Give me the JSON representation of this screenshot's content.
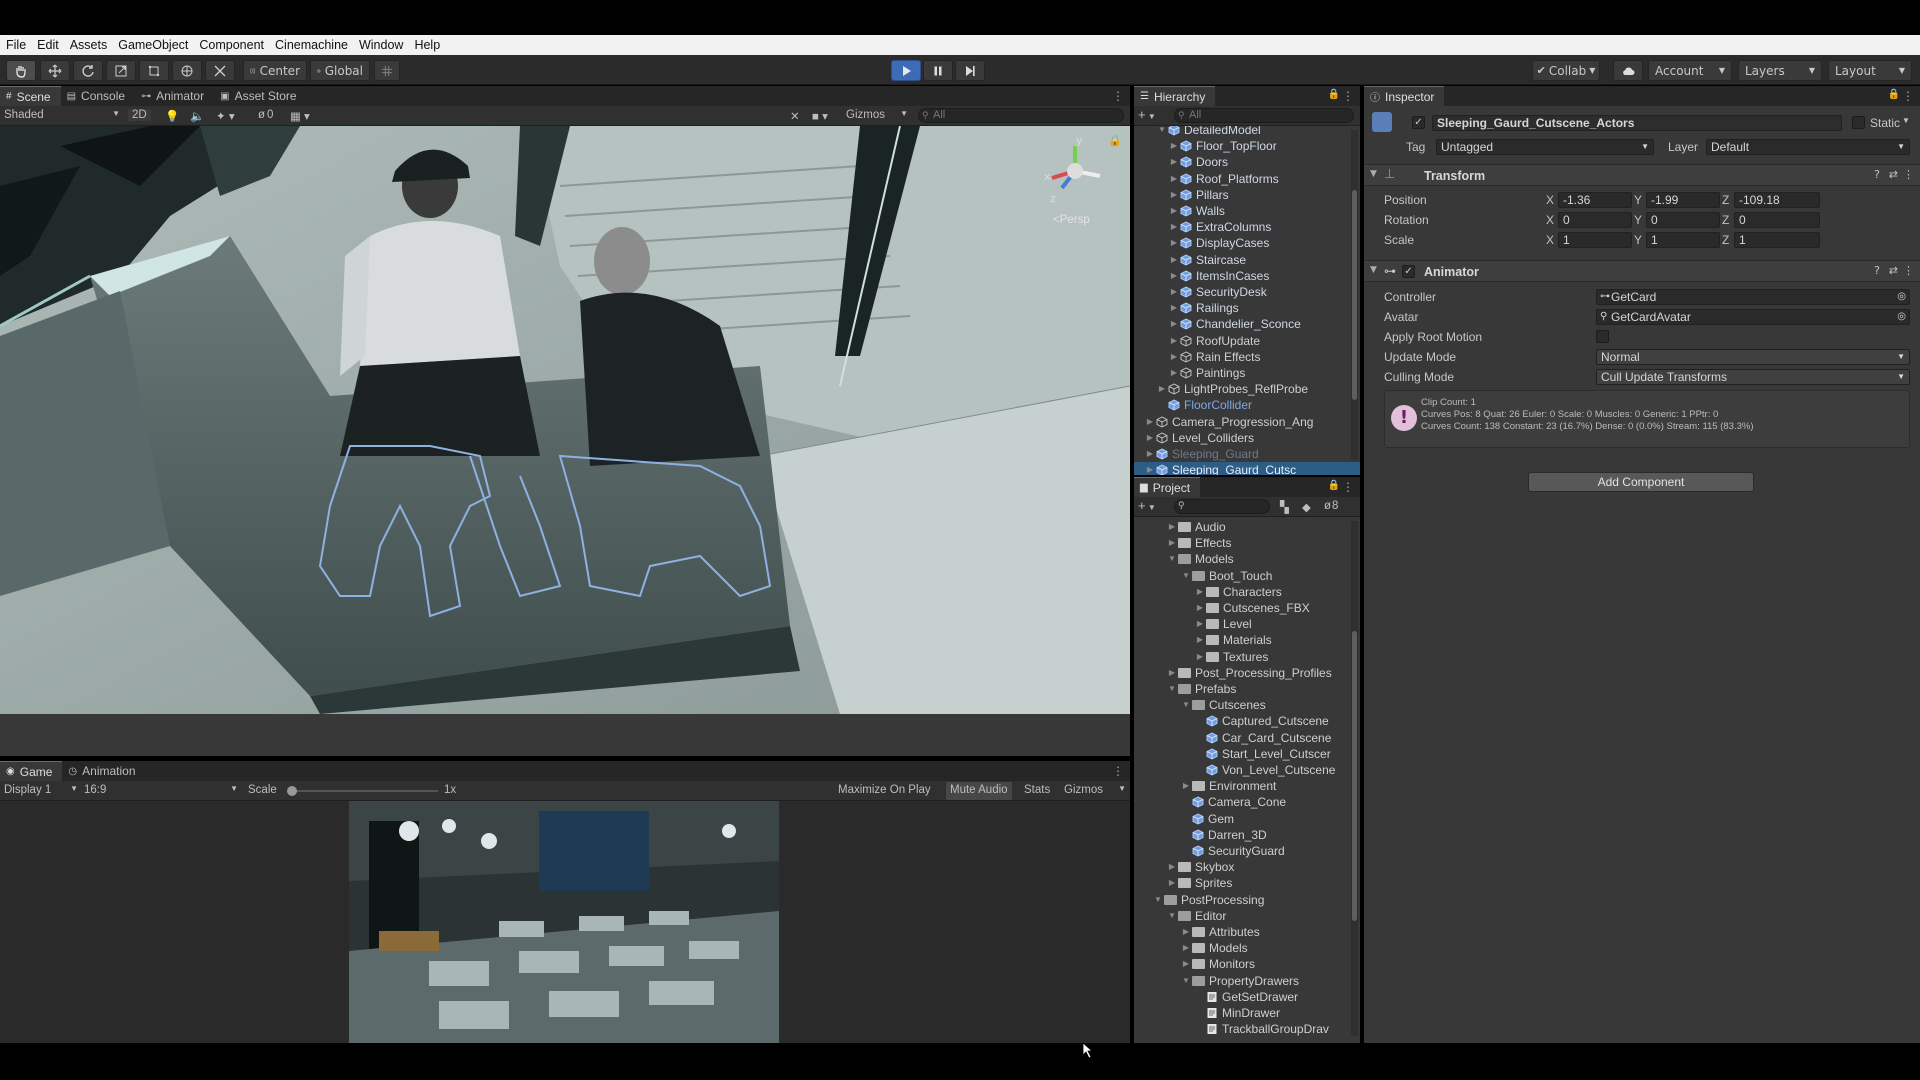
{
  "menu": [
    "File",
    "Edit",
    "Assets",
    "GameObject",
    "Component",
    "Cinemachine",
    "Window",
    "Help"
  ],
  "toolbar": {
    "pivot": "Center",
    "space": "Global",
    "collab": "Collab",
    "account": "Account",
    "layers": "Layers",
    "layout": "Layout"
  },
  "scene_panel": {
    "tabs": [
      "Scene",
      "Console",
      "Animator",
      "Asset Store"
    ],
    "shading": "Shaded",
    "mode2d": "2D",
    "fx_count": "0",
    "gizmos": "Gizmos",
    "search_placeholder": "All",
    "persp": "<Persp",
    "axis_x": "x",
    "axis_y": "y",
    "axis_z": "z"
  },
  "game_panel": {
    "tabs": [
      "Game",
      "Animation"
    ],
    "display": "Display 1",
    "aspect": "16:9",
    "scale_label": "Scale",
    "scale_value": "1x",
    "maximize": "Maximize On Play",
    "mute": "Mute Audio",
    "stats": "Stats",
    "gizmos": "Gizmos"
  },
  "hierarchy": {
    "title": "Hierarchy",
    "search_placeholder": "All",
    "items": [
      {
        "label": "DetailedModel",
        "depth": 4,
        "icon": "prefab",
        "arrow": "open"
      },
      {
        "label": "Floor_TopFloor",
        "depth": 5,
        "icon": "prefab",
        "arrow": "closed"
      },
      {
        "label": "Doors",
        "depth": 5,
        "icon": "prefab",
        "arrow": "closed"
      },
      {
        "label": "Roof_Platforms",
        "depth": 5,
        "icon": "prefab",
        "arrow": "closed"
      },
      {
        "label": "Pillars",
        "depth": 5,
        "icon": "prefab",
        "arrow": "closed"
      },
      {
        "label": "Walls",
        "depth": 5,
        "icon": "prefab",
        "arrow": "closed"
      },
      {
        "label": "ExtraColumns",
        "depth": 5,
        "icon": "prefab",
        "arrow": "closed"
      },
      {
        "label": "DisplayCases",
        "depth": 5,
        "icon": "prefab",
        "arrow": "closed"
      },
      {
        "label": "Staircase",
        "depth": 5,
        "icon": "prefab",
        "arrow": "closed"
      },
      {
        "label": "ItemsInCases",
        "depth": 5,
        "icon": "prefab",
        "arrow": "closed"
      },
      {
        "label": "SecurityDesk",
        "depth": 5,
        "icon": "prefab",
        "arrow": "closed"
      },
      {
        "label": "Railings",
        "depth": 5,
        "icon": "prefab",
        "arrow": "closed"
      },
      {
        "label": "Chandelier_Sconce",
        "depth": 5,
        "icon": "prefab",
        "arrow": "closed"
      },
      {
        "label": "RoofUpdate",
        "depth": 5,
        "icon": "cube",
        "arrow": "closed"
      },
      {
        "label": "Rain Effects",
        "depth": 5,
        "icon": "cube",
        "arrow": "closed"
      },
      {
        "label": "Paintings",
        "depth": 5,
        "icon": "cube",
        "arrow": "closed"
      },
      {
        "label": "LightProbes_ReflProbe",
        "depth": 4,
        "icon": "cube",
        "arrow": "closed"
      },
      {
        "label": "FloorCollider",
        "depth": 4,
        "icon": "prefab",
        "arrow": "none",
        "blue": true
      },
      {
        "label": "Camera_Progression_Ang",
        "depth": 3,
        "icon": "cube",
        "arrow": "closed"
      },
      {
        "label": "Level_Colliders",
        "depth": 3,
        "icon": "cube",
        "arrow": "closed"
      },
      {
        "label": "Sleeping_Guard",
        "depth": 3,
        "icon": "prefab",
        "arrow": "closed",
        "dim": true
      },
      {
        "label": "Sleeping_Gaurd_Cutsc",
        "depth": 3,
        "icon": "prefab",
        "arrow": "closed",
        "selected": true
      }
    ]
  },
  "project": {
    "title": "Project",
    "hidden_count": "8",
    "items": [
      {
        "label": "Audio",
        "depth": 2,
        "arrow": "closed",
        "type": "folder"
      },
      {
        "label": "Effects",
        "depth": 2,
        "arrow": "closed",
        "type": "folder"
      },
      {
        "label": "Models",
        "depth": 2,
        "arrow": "open",
        "type": "folder"
      },
      {
        "label": "Boot_Touch",
        "depth": 3,
        "arrow": "open",
        "type": "folder"
      },
      {
        "label": "Characters",
        "depth": 4,
        "arrow": "closed",
        "type": "folder"
      },
      {
        "label": "Cutscenes_FBX",
        "depth": 4,
        "arrow": "closed",
        "type": "folder"
      },
      {
        "label": "Level",
        "depth": 4,
        "arrow": "closed",
        "type": "folder"
      },
      {
        "label": "Materials",
        "depth": 4,
        "arrow": "closed",
        "type": "folder"
      },
      {
        "label": "Textures",
        "depth": 4,
        "arrow": "closed",
        "type": "folder"
      },
      {
        "label": "Post_Processing_Profiles",
        "depth": 2,
        "arrow": "closed",
        "type": "folder"
      },
      {
        "label": "Prefabs",
        "depth": 2,
        "arrow": "open",
        "type": "folder"
      },
      {
        "label": "Cutscenes",
        "depth": 3,
        "arrow": "open",
        "type": "folder"
      },
      {
        "label": "Captured_Cutscene",
        "depth": 4,
        "arrow": "none",
        "type": "prefab"
      },
      {
        "label": "Car_Card_Cutscene",
        "depth": 4,
        "arrow": "none",
        "type": "prefab"
      },
      {
        "label": "Start_Level_Cutscer",
        "depth": 4,
        "arrow": "none",
        "type": "prefab"
      },
      {
        "label": "Von_Level_Cutscene",
        "depth": 4,
        "arrow": "none",
        "type": "prefab"
      },
      {
        "label": "Environment",
        "depth": 3,
        "arrow": "closed",
        "type": "folder"
      },
      {
        "label": "Camera_Cone",
        "depth": 3,
        "arrow": "none",
        "type": "prefab"
      },
      {
        "label": "Gem",
        "depth": 3,
        "arrow": "none",
        "type": "prefab"
      },
      {
        "label": "Darren_3D",
        "depth": 3,
        "arrow": "none",
        "type": "prefab"
      },
      {
        "label": "SecurityGuard",
        "depth": 3,
        "arrow": "none",
        "type": "prefab"
      },
      {
        "label": "Skybox",
        "depth": 2,
        "arrow": "closed",
        "type": "folder"
      },
      {
        "label": "Sprites",
        "depth": 2,
        "arrow": "closed",
        "type": "folder"
      },
      {
        "label": "PostProcessing",
        "depth": 1,
        "arrow": "open",
        "type": "folder"
      },
      {
        "label": "Editor",
        "depth": 2,
        "arrow": "open",
        "type": "folder"
      },
      {
        "label": "Attributes",
        "depth": 3,
        "arrow": "closed",
        "type": "folder"
      },
      {
        "label": "Models",
        "depth": 3,
        "arrow": "closed",
        "type": "folder"
      },
      {
        "label": "Monitors",
        "depth": 3,
        "arrow": "closed",
        "type": "folder"
      },
      {
        "label": "PropertyDrawers",
        "depth": 3,
        "arrow": "open",
        "type": "folder"
      },
      {
        "label": "GetSetDrawer",
        "depth": 4,
        "arrow": "none",
        "type": "script"
      },
      {
        "label": "MinDrawer",
        "depth": 4,
        "arrow": "none",
        "type": "script"
      },
      {
        "label": "TrackballGroupDrav",
        "depth": 4,
        "arrow": "none",
        "type": "script"
      }
    ]
  },
  "inspector": {
    "title": "Inspector",
    "object_name": "Sleeping_Gaurd_Cutscene_Actors",
    "static": "Static",
    "tag_label": "Tag",
    "tag_value": "Untagged",
    "layer_label": "Layer",
    "layer_value": "Default",
    "transform": {
      "title": "Transform",
      "position_label": "Position",
      "rotation_label": "Rotation",
      "scale_label": "Scale",
      "position": {
        "x": "-1.36",
        "y": "-1.99",
        "z": "-109.18"
      },
      "rotation": {
        "x": "0",
        "y": "0",
        "z": "0"
      },
      "scale": {
        "x": "1",
        "y": "1",
        "z": "1"
      }
    },
    "animator": {
      "title": "Animator",
      "controller_label": "Controller",
      "controller_value": "GetCard",
      "avatar_label": "Avatar",
      "avatar_value": "GetCardAvatar",
      "root_motion_label": "Apply Root Motion",
      "update_mode_label": "Update Mode",
      "update_mode_value": "Normal",
      "culling_label": "Culling Mode",
      "culling_value": "Cull Update Transforms",
      "info_line1": "Clip Count: 1",
      "info_line2": "Curves Pos: 8 Quat: 26 Euler: 0 Scale: 0 Muscles: 0 Generic: 1 PPtr: 0",
      "info_line3": "Curves Count: 138 Constant: 23 (16.7%) Dense: 0 (0.0%) Stream: 115 (83.3%)"
    },
    "add_component": "Add Component"
  },
  "colors": {
    "accent": "#4a7bd6",
    "selected_row": "#2c5d87",
    "prefab_blue": "#7fa8e8"
  }
}
